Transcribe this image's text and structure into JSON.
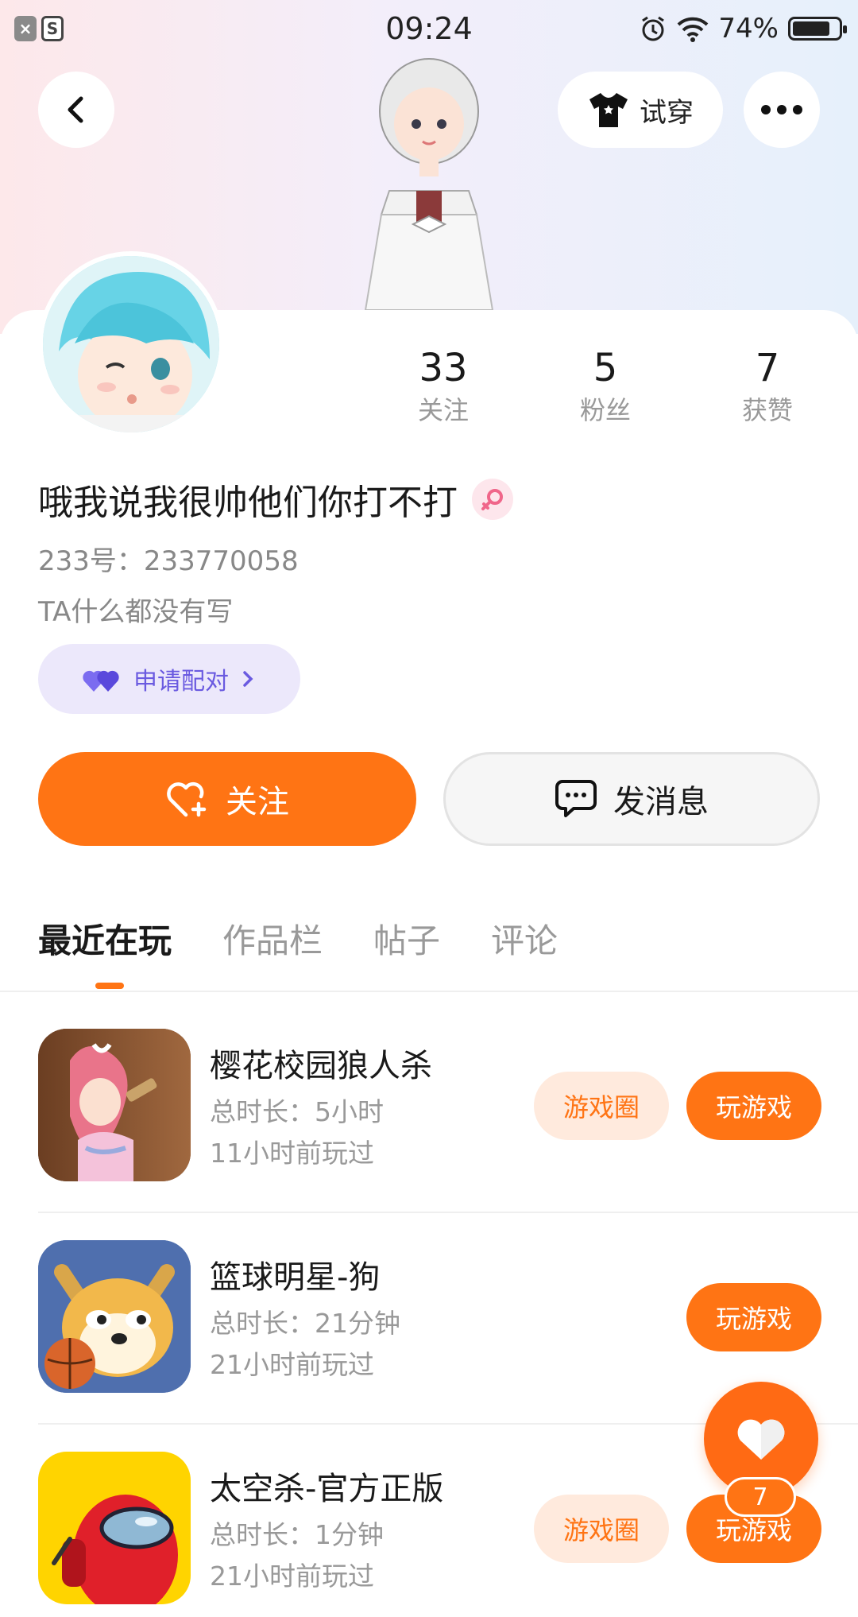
{
  "status_bar": {
    "time": "09:24",
    "battery": "74%",
    "battery_level": 0.74
  },
  "header": {
    "tryon_label": "试穿"
  },
  "profile": {
    "stats": [
      {
        "value": "33",
        "label": "关注"
      },
      {
        "value": "5",
        "label": "粉丝"
      },
      {
        "value": "7",
        "label": "获赞"
      }
    ],
    "nickname": "哦我说我很帅他们你打不打",
    "uid": "233号：233770058",
    "bio": "TA什么都没有写",
    "match_label": "申请配对",
    "follow_label": "关注",
    "message_label": "发消息"
  },
  "tabs": [
    "最近在玩",
    "作品栏",
    "帖子",
    "评论"
  ],
  "games": [
    {
      "name": "樱花校园狼人杀",
      "duration": "总时长：5小时",
      "last_played": "11小时前玩过",
      "circle_label": "游戏圈",
      "play_label": "玩游戏"
    },
    {
      "name": "篮球明星-狗",
      "duration": "总时长：21分钟",
      "last_played": "21小时前玩过",
      "circle_label": "",
      "play_label": "玩游戏"
    },
    {
      "name": "太空杀-官方正版",
      "duration": "总时长：1分钟",
      "last_played": "21小时前玩过",
      "circle_label": "游戏圈",
      "play_label": "玩游戏"
    }
  ],
  "fab": {
    "count": "7"
  },
  "colors": {
    "accent": "#ff7414",
    "match_purple": "#6a5ae0"
  }
}
